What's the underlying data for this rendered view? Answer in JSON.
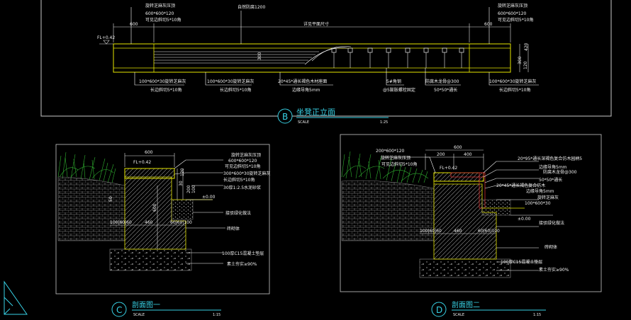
{
  "colors": {
    "background": "#000000",
    "frame": "#c8c8c8",
    "dim": "#e0e0e0",
    "outline": "#e6e600",
    "leader": "#ffffff",
    "title": "#38d2e6",
    "cyan": "#00e0e0",
    "green": "#30b030",
    "hatch": "#8a8a8a",
    "red": "#d03030"
  },
  "elevation": {
    "top_left_note1": "旋转芝麻灰压顶",
    "top_left_note2": "600*600*120",
    "top_left_note3": "可见边斜切5*10角",
    "top_center_note": "自然防腐1200",
    "top_right_note1": "旋转芝麻灰压顶",
    "top_right_note2": "600*600*120",
    "top_right_note3": "可见边斜切5*10角",
    "dim_left": "600",
    "dim_right": "600",
    "dim_center": "详见平面尺寸",
    "fl_label": "FL+0.42",
    "dim_300": "300",
    "dim_420": "420",
    "dim_120": "120",
    "dim_inner": "300",
    "b1_label1": "100*600*30旋转芝麻灰",
    "b1_label2": "长边斜切5*10角",
    "b2_label1": "100*600*30旋转芝麻灰",
    "b2_label2": "长边斜切5*10角",
    "wood_note1": "20*45*通长褐色木材座面",
    "wood_note2": "边缘导角5mm",
    "screw_note1": "5#角钢",
    "screw_note2": "@5膨胀螺栓固定",
    "steel_note1": "防腐木龙骨@300",
    "steel_note2": "50*50*通长",
    "b3_label1": "100*600*30旋转芝麻灰",
    "b3_label2": "长边斜切5*10角"
  },
  "title_b": {
    "letter": "B",
    "name": "坐凳正立面",
    "scale_label": "SCALE",
    "scale_value": "1:25"
  },
  "section_c": {
    "dim_600": "600",
    "fl_label": "FL+0.42",
    "n1": "旋转芝麻灰压顶",
    "n2": "600*600*120",
    "n3": "可见边斜切5*10角",
    "n4": "300*600*30旋转芝麻灰",
    "n5": "长边斜切5*10角",
    "n6": "30厚1:2.5水泥砂浆",
    "level": "±0.00",
    "n7": "接驳绿化做法",
    "n8": "砖砌体",
    "n9": "100厚C15混凝土垫层",
    "n10": "素土夯实≥90%",
    "dim_600v": "600",
    "dim_460": "460",
    "dim_100060": "100|60|60",
    "dim_606100": "60|60|100",
    "dim_50": "50",
    "dim_120": "120",
    "dim_30": "30",
    "dim_200": "200",
    "dim_100": "100"
  },
  "title_c": {
    "letter": "C",
    "name": "剖面图一",
    "scale_label": "SCALE",
    "scale_value": "1:15"
  },
  "section_d": {
    "n0": "200*600*120",
    "n0b": "旋转芝麻灰压顶",
    "n0c": "可见边斜切5*10角",
    "dim_600": "600",
    "dim_200": "200",
    "dim_400": "400",
    "fl_label": "FL+0.42",
    "n1": "20*95*通长深褐色复合仿木园柄5",
    "n2": "边缘导角5mm",
    "n3": "防腐木龙骨@300",
    "n4": "50*50*通长",
    "n5": "20*45*通长褐色复合仿木",
    "n6": "边缘导角5mm",
    "n7": "旋转芝麻灰",
    "n8": "100*600*30",
    "level": "±0.00",
    "n9": "接驳绿化做法",
    "n10": "砖砌体",
    "n11": "100厚C15混凝土垫层",
    "n12": "素土夯实≥90%",
    "dim_100060": "100|60|60",
    "dim_460": "460",
    "dim_606100": "60|60|100"
  },
  "title_d": {
    "letter": "D",
    "name": "剖面图二",
    "scale_label": "SCALE",
    "scale_value": "1:15"
  }
}
